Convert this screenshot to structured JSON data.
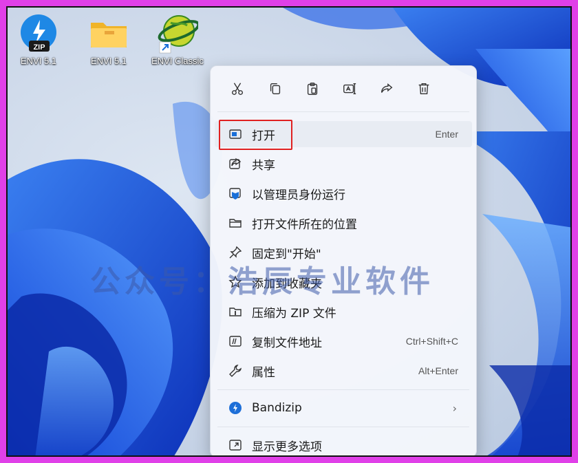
{
  "desktop": {
    "icons": [
      {
        "label": "ENVI 5.1",
        "icon": "zip-app-icon"
      },
      {
        "label": "ENVI 5.1",
        "icon": "folder-icon"
      },
      {
        "label": "ENVI Classic",
        "icon": "globe-shortcut-icon"
      }
    ],
    "watermark": "公众号：浩辰专业软件"
  },
  "context_menu": {
    "toolbar": [
      {
        "name": "cut",
        "icon": "scissors-icon"
      },
      {
        "name": "copy",
        "icon": "copy-icon"
      },
      {
        "name": "paste",
        "icon": "paste-icon"
      },
      {
        "name": "rename",
        "icon": "rename-icon"
      },
      {
        "name": "share",
        "icon": "share-icon"
      },
      {
        "name": "delete",
        "icon": "trash-icon"
      }
    ],
    "items": [
      {
        "label": "打开",
        "shortcut": "Enter",
        "icon": "open-window-icon"
      },
      {
        "label": "共享",
        "shortcut": "",
        "icon": "share-icon"
      },
      {
        "label": "以管理员身份运行",
        "shortcut": "",
        "icon": "admin-shield-icon"
      },
      {
        "label": "打开文件所在的位置",
        "shortcut": "",
        "icon": "folder-icon"
      },
      {
        "label": "固定到\"开始\"",
        "shortcut": "",
        "icon": "pin-icon"
      },
      {
        "label": "添加到收藏夹",
        "shortcut": "",
        "icon": "star-icon"
      },
      {
        "label": "压缩为 ZIP 文件",
        "shortcut": "",
        "icon": "zip-icon"
      },
      {
        "label": "复制文件地址",
        "shortcut": "Ctrl+Shift+C",
        "icon": "copy-path-icon"
      },
      {
        "label": "属性",
        "shortcut": "Alt+Enter",
        "icon": "wrench-icon"
      },
      {
        "label": "Bandizip",
        "shortcut": "",
        "icon": "bandizip-icon"
      },
      {
        "label": "显示更多选项",
        "shortcut": "",
        "icon": "more-options-icon"
      }
    ],
    "highlight_color": "#e02020"
  }
}
